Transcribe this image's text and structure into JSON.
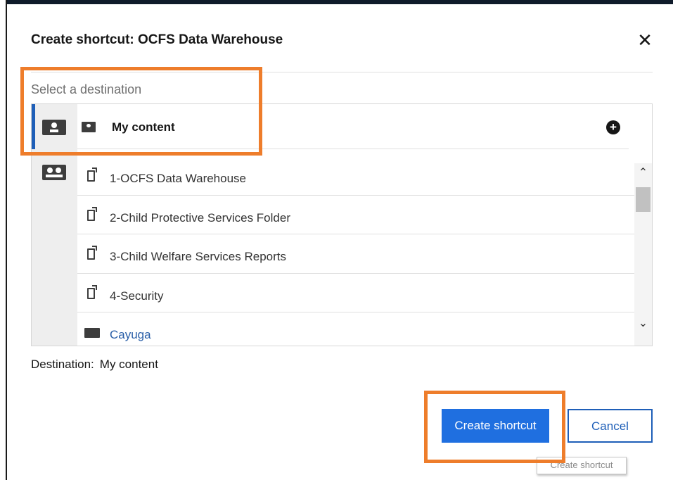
{
  "dialog": {
    "title": "Create shortcut:  OCFS Data Warehouse",
    "close_glyph": "✕",
    "close_icon": "close-icon"
  },
  "browser": {
    "section_label": "Select a destination",
    "header_label": "My content",
    "header_icon": "user-folder-icon",
    "add_glyph": "+",
    "add_icon": "add-circle-icon",
    "rail_icons": [
      "my-content-icon",
      "team-content-icon"
    ],
    "items": [
      {
        "label": "1-OCFS Data Warehouse",
        "icon": "shortcut-icon"
      },
      {
        "label": "2-Child Protective Services Folder",
        "icon": "shortcut-icon"
      },
      {
        "label": "3-Child Welfare Services Reports",
        "icon": "shortcut-icon"
      },
      {
        "label": "4-Security",
        "icon": "shortcut-icon"
      },
      {
        "label": "Cayuga",
        "icon": "folder-icon"
      }
    ],
    "scroll_up_glyph": "⌃",
    "scroll_down_glyph": "⌄"
  },
  "destination": {
    "label": "Destination:",
    "value": "My content"
  },
  "actions": {
    "create_label": "Create shortcut",
    "cancel_label": "Cancel",
    "tooltip": "Create shortcut"
  },
  "colors": {
    "primary": "#1f6fe0",
    "highlight": "#ee7d2b",
    "rail_active": "#1f5fb8",
    "link": "#2a5fa8"
  }
}
